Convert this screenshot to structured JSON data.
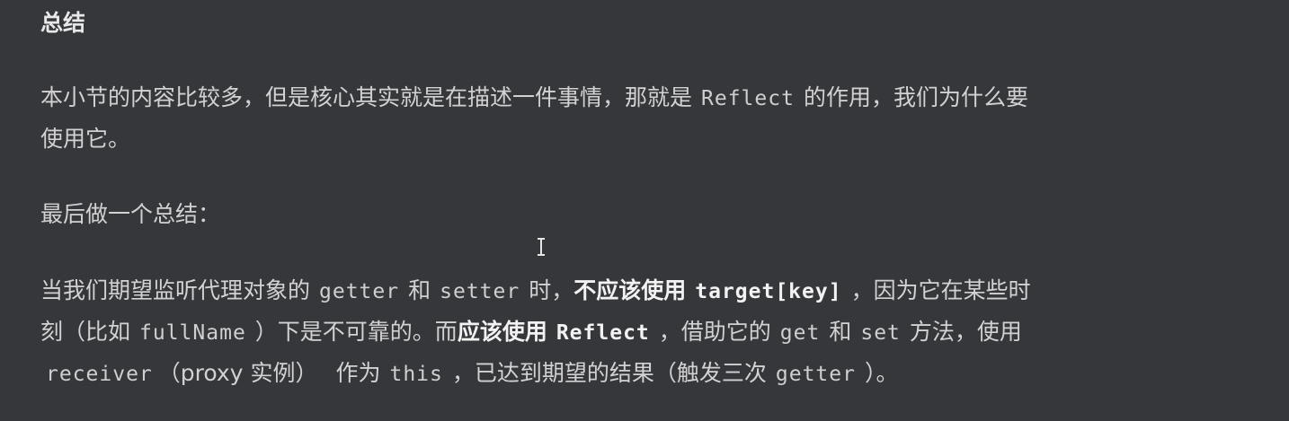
{
  "heading": "总结",
  "para1": {
    "line1_a": "本小节的内容比较多，但是核心其实就是在描述一件事情，那就是",
    "line1_code": "Reflect",
    "line1_b": "的作用，我们为什么要",
    "line2": "使用它。"
  },
  "para2": "最后做一个总结：",
  "para3": {
    "l1_a": "当我们期望监听代理对象的",
    "l1_code1": "getter",
    "l1_b": "和",
    "l1_code2": "setter",
    "l1_c": "时，",
    "l1_bold": "不应该使用",
    "l1_code3": "target[key]",
    "l1_d": "，因为它在某些时",
    "l2_a": "刻（比如",
    "l2_code1": "fullName",
    "l2_b": "）下是不可靠的。而",
    "l2_bold": "应该使用",
    "l2_code2": "Reflect",
    "l2_c": "，借助它的",
    "l2_code3": "get",
    "l2_d": "和",
    "l2_code4": "set",
    "l2_e": "方法，使用",
    "l3_code1": "receiver",
    "l3_a": "（proxy 实例）",
    "l3_b": "作为",
    "l3_code2": "this",
    "l3_c": "，已达到期望的结果（触发三次",
    "l3_code3": "getter",
    "l3_d": "）。"
  }
}
